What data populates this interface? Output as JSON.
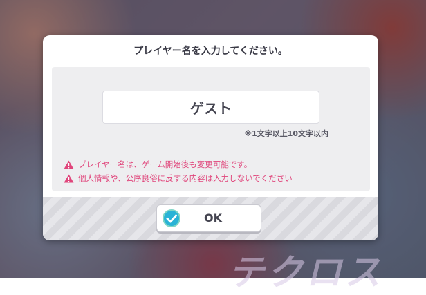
{
  "dialog": {
    "title": "プレイヤー名を入力してください。",
    "name_input": {
      "value": "ゲスト"
    },
    "hint": "※1文字以上10文字以内",
    "warnings": [
      {
        "icon": "warning-icon",
        "text": "プレイヤー名は、ゲーム開始後も変更可能です。"
      },
      {
        "icon": "warning-icon",
        "text": "個人情報や、公序良俗に反する内容は入力しないでください"
      }
    ],
    "ok_button": {
      "label": "OK",
      "icon": "check-circle-icon"
    }
  },
  "background": {
    "logo_text": "テクロス"
  },
  "colors": {
    "warning": "#e0457b",
    "check_accent": "#29b3d6"
  }
}
